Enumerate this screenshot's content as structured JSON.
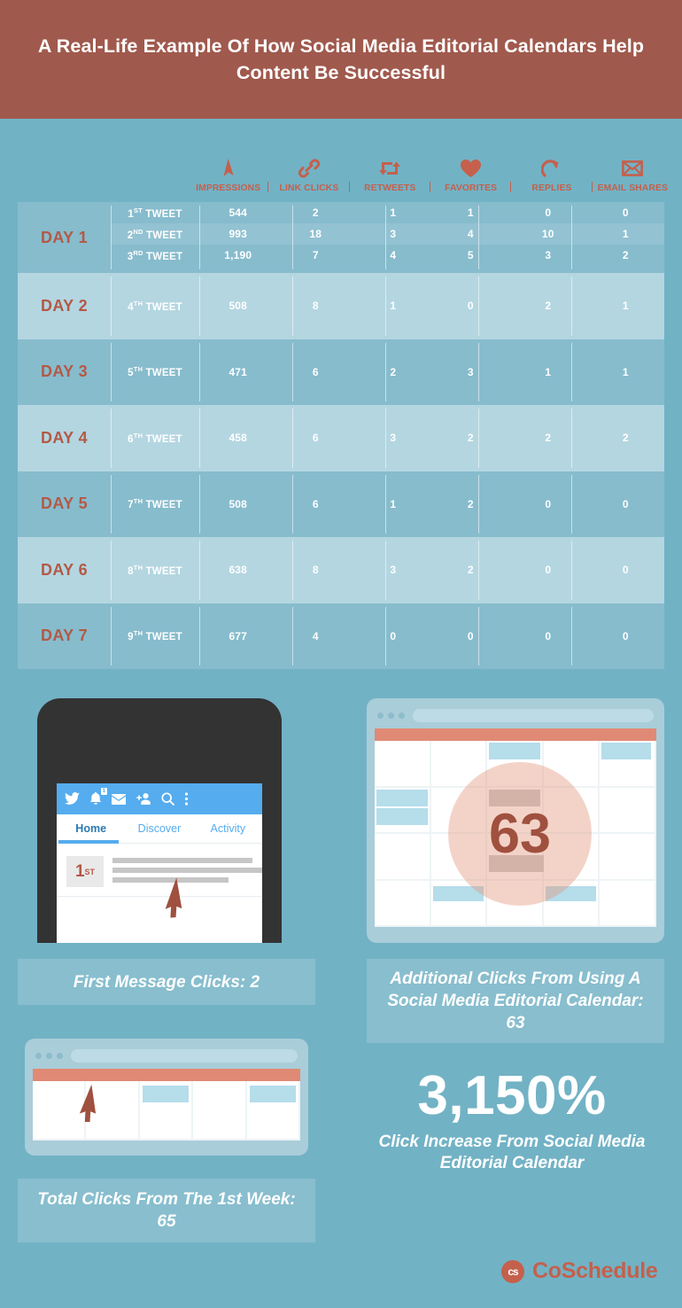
{
  "header": {
    "title": "A Real-Life Example Of How Social Media Editorial Calendars Help Content Be Successful"
  },
  "colors": {
    "background": "#72b2c5",
    "header_band": "#a0594d",
    "accent_rust": "#c4604c",
    "day_label": "#b35946",
    "row_dark": "#87bccd",
    "row_light": "#b4d6e1",
    "browser_frame": "#a9cdd9",
    "calendar_topbar": "#e08a75",
    "event_blue": "#b5ddea",
    "twitter_blue": "#55acee"
  },
  "table": {
    "columns": [
      {
        "label": "IMPRESSIONS",
        "icon": "cursor-arrow-icon"
      },
      {
        "label": "LINK CLICKS",
        "icon": "link-icon"
      },
      {
        "label": "RETWEETS",
        "icon": "retweet-icon"
      },
      {
        "label": "FAVORITES",
        "icon": "heart-icon"
      },
      {
        "label": "REPLIES",
        "icon": "reply-icon"
      },
      {
        "label": "EMAIL SHARES",
        "icon": "envelope-icon"
      }
    ],
    "days": [
      {
        "day": "DAY 1",
        "rows": [
          {
            "tweet": "1",
            "ord": "ST",
            "tweet_label": "TWEET",
            "values": [
              "544",
              "2",
              "1",
              "1",
              "0",
              "0"
            ]
          },
          {
            "tweet": "2",
            "ord": "ND",
            "tweet_label": "TWEET",
            "values": [
              "993",
              "18",
              "3",
              "4",
              "10",
              "1"
            ]
          },
          {
            "tweet": "3",
            "ord": "RD",
            "tweet_label": "TWEET",
            "values": [
              "1,190",
              "7",
              "4",
              "5",
              "3",
              "2"
            ]
          }
        ]
      },
      {
        "day": "DAY 2",
        "rows": [
          {
            "tweet": "4",
            "ord": "TH",
            "tweet_label": "TWEET",
            "values": [
              "508",
              "8",
              "1",
              "0",
              "2",
              "1"
            ]
          }
        ]
      },
      {
        "day": "DAY 3",
        "rows": [
          {
            "tweet": "5",
            "ord": "TH",
            "tweet_label": "TWEET",
            "values": [
              "471",
              "6",
              "2",
              "3",
              "1",
              "1"
            ]
          }
        ]
      },
      {
        "day": "DAY 4",
        "rows": [
          {
            "tweet": "6",
            "ord": "TH",
            "tweet_label": "TWEET",
            "values": [
              "458",
              "6",
              "3",
              "2",
              "2",
              "2"
            ]
          }
        ]
      },
      {
        "day": "DAY 5",
        "rows": [
          {
            "tweet": "7",
            "ord": "TH",
            "tweet_label": "TWEET",
            "values": [
              "508",
              "6",
              "1",
              "2",
              "0",
              "0"
            ]
          }
        ]
      },
      {
        "day": "DAY 6",
        "rows": [
          {
            "tweet": "8",
            "ord": "TH",
            "tweet_label": "TWEET",
            "values": [
              "638",
              "8",
              "3",
              "2",
              "0",
              "0"
            ]
          }
        ]
      },
      {
        "day": "DAY 7",
        "rows": [
          {
            "tweet": "9",
            "ord": "TH",
            "tweet_label": "TWEET",
            "values": [
              "677",
              "4",
              "0",
              "0",
              "0",
              "0"
            ]
          }
        ]
      }
    ]
  },
  "phone": {
    "tabs": [
      {
        "label": "Home",
        "active": true
      },
      {
        "label": "Discover",
        "active": false
      },
      {
        "label": "Activity",
        "active": false
      }
    ],
    "notification_badge": "1",
    "avatar_number": "1",
    "avatar_ordinal": "ST"
  },
  "calendar_badge": "63",
  "captions": {
    "first_message_clicks": "First Message Clicks: 2",
    "additional_clicks": "Additional Clicks From Using A Social Media Editorial Calendar: 63",
    "total_clicks": "Total Clicks From The 1st Week: 65"
  },
  "big_stat": {
    "number": "3,150%",
    "caption": "Click Increase From Social Media Editorial Calendar"
  },
  "logo": {
    "mark": "cs",
    "name": "CoSchedule"
  }
}
